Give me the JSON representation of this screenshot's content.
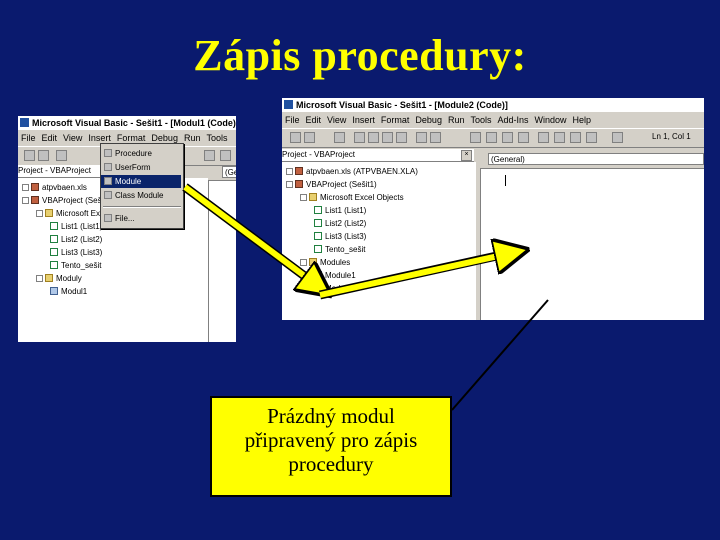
{
  "slide": {
    "title": "Zápis procedury:",
    "callout_lines": [
      "Prázdný modul",
      "připravený pro zápis",
      "procedury"
    ],
    "callout_color": "#ffff00",
    "background_color": "#0a1a6e",
    "title_color": "#ffff00"
  },
  "left_window": {
    "title": "Microsoft Visual Basic - Sešit1 - [Modul1 (Code)]",
    "menu": [
      "File",
      "Edit",
      "View",
      "Insert",
      "Format",
      "Debug",
      "Run",
      "Tools"
    ],
    "project_panel_title": "Project - VBAProject",
    "code_combo": "(Ge",
    "tree": [
      {
        "label": "atpvbaen.xls",
        "icon": "project",
        "indent": 0
      },
      {
        "label": "VBAProject (Sešit1)",
        "icon": "project",
        "indent": 0
      },
      {
        "label": "Microsoft Excel Objects",
        "icon": "folder",
        "indent": 1
      },
      {
        "label": "List1 (List1)",
        "icon": "sheet",
        "indent": 2
      },
      {
        "label": "List2 (List2)",
        "icon": "sheet",
        "indent": 2
      },
      {
        "label": "List3 (List3)",
        "icon": "sheet",
        "indent": 2
      },
      {
        "label": "Tento_sešit",
        "icon": "sheet",
        "indent": 2
      },
      {
        "label": "Moduly",
        "icon": "folder",
        "indent": 1
      },
      {
        "label": "Modul1",
        "icon": "module",
        "indent": 2
      }
    ],
    "insert_menu": [
      {
        "label": "Procedure",
        "selected": false
      },
      {
        "label": "UserForm",
        "selected": false
      },
      {
        "label": "Module",
        "selected": true
      },
      {
        "label": "Class Module",
        "selected": false
      },
      {
        "label": "File...",
        "selected": false
      }
    ]
  },
  "right_window": {
    "title": "Microsoft Visual Basic - Sešit1 - [Module2 (Code)]",
    "menu": [
      "File",
      "Edit",
      "View",
      "Insert",
      "Format",
      "Debug",
      "Run",
      "Tools",
      "Add-Ins",
      "Window",
      "Help"
    ],
    "toolbar_right": "Ln 1, Col 1",
    "project_panel_title": "Project - VBAProject",
    "code_combo": "(General)",
    "tree": [
      {
        "label": "atpvbaen.xls (ATPVBAEN.XLA)",
        "icon": "project",
        "indent": 0
      },
      {
        "label": "VBAProject (Sešit1)",
        "icon": "project",
        "indent": 0
      },
      {
        "label": "Microsoft Excel Objects",
        "icon": "folder",
        "indent": 1
      },
      {
        "label": "List1 (List1)",
        "icon": "sheet",
        "indent": 2
      },
      {
        "label": "List2 (List2)",
        "icon": "sheet",
        "indent": 2
      },
      {
        "label": "List3 (List3)",
        "icon": "sheet",
        "indent": 2
      },
      {
        "label": "Tento_sešit",
        "icon": "sheet",
        "indent": 2
      },
      {
        "label": "Modules",
        "icon": "folder",
        "indent": 1
      },
      {
        "label": "Module1",
        "icon": "module",
        "indent": 2
      },
      {
        "label": "Module2",
        "icon": "module",
        "indent": 2
      }
    ]
  }
}
